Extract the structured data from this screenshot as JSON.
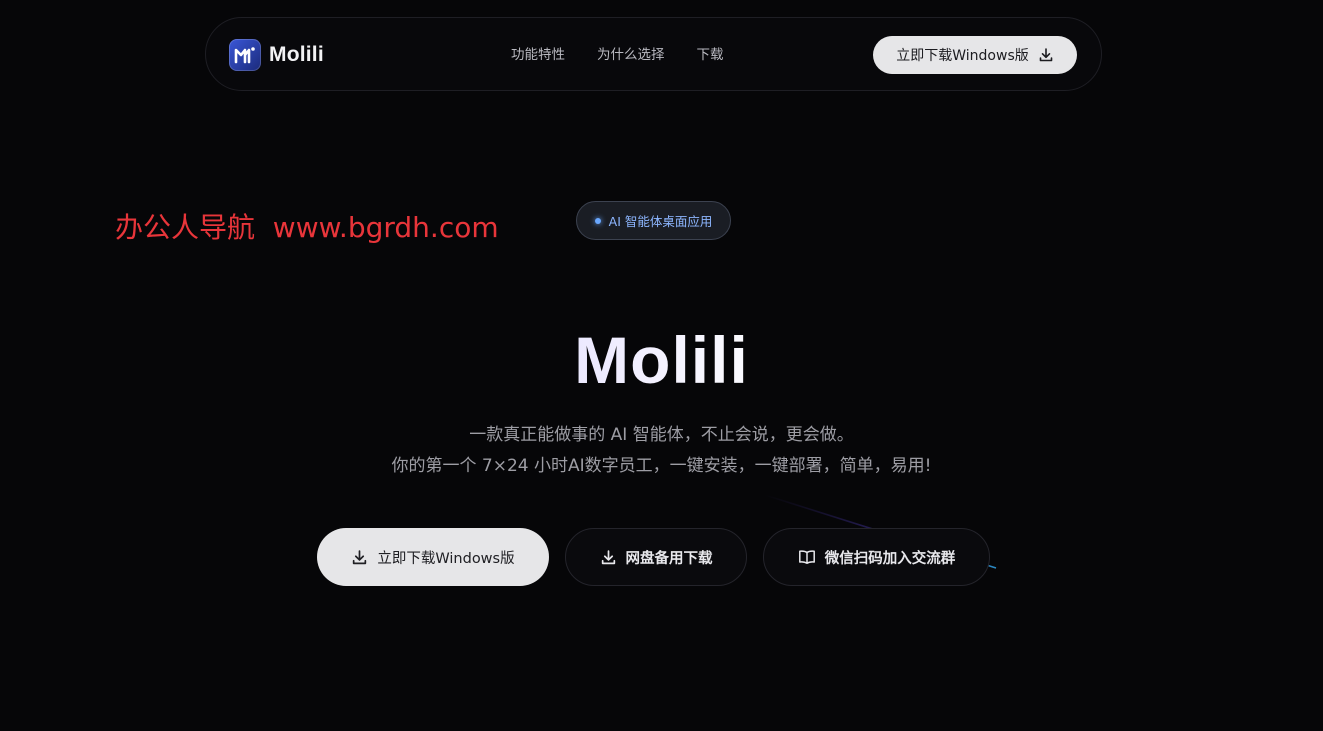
{
  "nav": {
    "brand": "Molili",
    "links": [
      "功能特性",
      "为什么选择",
      "下载"
    ],
    "cta_label": "立即下载Windows版"
  },
  "watermark": {
    "text": "办公人导航  www.bgrdh.com"
  },
  "hero": {
    "badge": "AI 智能体桌面应用",
    "title": "Molili",
    "subtitle_line1": "一款真正能做事的 AI 智能体，不止会说，更会做。",
    "subtitle_line2": "你的第一个 7×24 小时AI数字员工，一键安装，一键部署，简单，易用!"
  },
  "actions": {
    "primary_label": "立即下载Windows版",
    "pan_label": "网盘备用下载",
    "wechat_label": "微信扫码加入交流群"
  },
  "icons": {
    "logo": "molili-logo-icon",
    "download": "download-icon",
    "book": "book-open-icon",
    "dot": "status-dot-icon"
  },
  "colors": {
    "background": "#060608",
    "accent_blue": "#6aa8ff",
    "watermark_red": "#e8353a",
    "button_light": "#e6e6e8"
  }
}
